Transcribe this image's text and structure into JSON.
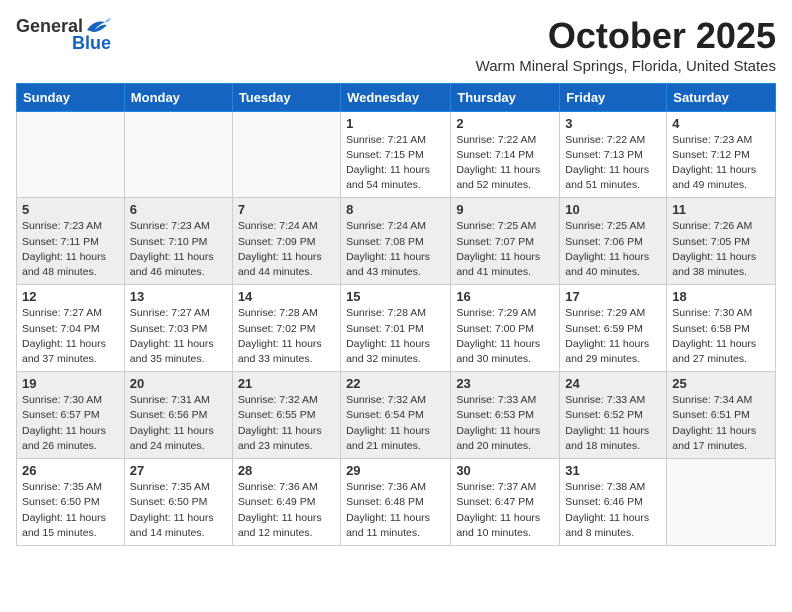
{
  "header": {
    "logo_general": "General",
    "logo_blue": "Blue",
    "month_title": "October 2025",
    "location": "Warm Mineral Springs, Florida, United States"
  },
  "calendar": {
    "days_of_week": [
      "Sunday",
      "Monday",
      "Tuesday",
      "Wednesday",
      "Thursday",
      "Friday",
      "Saturday"
    ],
    "weeks": [
      [
        {
          "day": "",
          "info": ""
        },
        {
          "day": "",
          "info": ""
        },
        {
          "day": "",
          "info": ""
        },
        {
          "day": "1",
          "info": "Sunrise: 7:21 AM\nSunset: 7:15 PM\nDaylight: 11 hours\nand 54 minutes."
        },
        {
          "day": "2",
          "info": "Sunrise: 7:22 AM\nSunset: 7:14 PM\nDaylight: 11 hours\nand 52 minutes."
        },
        {
          "day": "3",
          "info": "Sunrise: 7:22 AM\nSunset: 7:13 PM\nDaylight: 11 hours\nand 51 minutes."
        },
        {
          "day": "4",
          "info": "Sunrise: 7:23 AM\nSunset: 7:12 PM\nDaylight: 11 hours\nand 49 minutes."
        }
      ],
      [
        {
          "day": "5",
          "info": "Sunrise: 7:23 AM\nSunset: 7:11 PM\nDaylight: 11 hours\nand 48 minutes."
        },
        {
          "day": "6",
          "info": "Sunrise: 7:23 AM\nSunset: 7:10 PM\nDaylight: 11 hours\nand 46 minutes."
        },
        {
          "day": "7",
          "info": "Sunrise: 7:24 AM\nSunset: 7:09 PM\nDaylight: 11 hours\nand 44 minutes."
        },
        {
          "day": "8",
          "info": "Sunrise: 7:24 AM\nSunset: 7:08 PM\nDaylight: 11 hours\nand 43 minutes."
        },
        {
          "day": "9",
          "info": "Sunrise: 7:25 AM\nSunset: 7:07 PM\nDaylight: 11 hours\nand 41 minutes."
        },
        {
          "day": "10",
          "info": "Sunrise: 7:25 AM\nSunset: 7:06 PM\nDaylight: 11 hours\nand 40 minutes."
        },
        {
          "day": "11",
          "info": "Sunrise: 7:26 AM\nSunset: 7:05 PM\nDaylight: 11 hours\nand 38 minutes."
        }
      ],
      [
        {
          "day": "12",
          "info": "Sunrise: 7:27 AM\nSunset: 7:04 PM\nDaylight: 11 hours\nand 37 minutes."
        },
        {
          "day": "13",
          "info": "Sunrise: 7:27 AM\nSunset: 7:03 PM\nDaylight: 11 hours\nand 35 minutes."
        },
        {
          "day": "14",
          "info": "Sunrise: 7:28 AM\nSunset: 7:02 PM\nDaylight: 11 hours\nand 33 minutes."
        },
        {
          "day": "15",
          "info": "Sunrise: 7:28 AM\nSunset: 7:01 PM\nDaylight: 11 hours\nand 32 minutes."
        },
        {
          "day": "16",
          "info": "Sunrise: 7:29 AM\nSunset: 7:00 PM\nDaylight: 11 hours\nand 30 minutes."
        },
        {
          "day": "17",
          "info": "Sunrise: 7:29 AM\nSunset: 6:59 PM\nDaylight: 11 hours\nand 29 minutes."
        },
        {
          "day": "18",
          "info": "Sunrise: 7:30 AM\nSunset: 6:58 PM\nDaylight: 11 hours\nand 27 minutes."
        }
      ],
      [
        {
          "day": "19",
          "info": "Sunrise: 7:30 AM\nSunset: 6:57 PM\nDaylight: 11 hours\nand 26 minutes."
        },
        {
          "day": "20",
          "info": "Sunrise: 7:31 AM\nSunset: 6:56 PM\nDaylight: 11 hours\nand 24 minutes."
        },
        {
          "day": "21",
          "info": "Sunrise: 7:32 AM\nSunset: 6:55 PM\nDaylight: 11 hours\nand 23 minutes."
        },
        {
          "day": "22",
          "info": "Sunrise: 7:32 AM\nSunset: 6:54 PM\nDaylight: 11 hours\nand 21 minutes."
        },
        {
          "day": "23",
          "info": "Sunrise: 7:33 AM\nSunset: 6:53 PM\nDaylight: 11 hours\nand 20 minutes."
        },
        {
          "day": "24",
          "info": "Sunrise: 7:33 AM\nSunset: 6:52 PM\nDaylight: 11 hours\nand 18 minutes."
        },
        {
          "day": "25",
          "info": "Sunrise: 7:34 AM\nSunset: 6:51 PM\nDaylight: 11 hours\nand 17 minutes."
        }
      ],
      [
        {
          "day": "26",
          "info": "Sunrise: 7:35 AM\nSunset: 6:50 PM\nDaylight: 11 hours\nand 15 minutes."
        },
        {
          "day": "27",
          "info": "Sunrise: 7:35 AM\nSunset: 6:50 PM\nDaylight: 11 hours\nand 14 minutes."
        },
        {
          "day": "28",
          "info": "Sunrise: 7:36 AM\nSunset: 6:49 PM\nDaylight: 11 hours\nand 12 minutes."
        },
        {
          "day": "29",
          "info": "Sunrise: 7:36 AM\nSunset: 6:48 PM\nDaylight: 11 hours\nand 11 minutes."
        },
        {
          "day": "30",
          "info": "Sunrise: 7:37 AM\nSunset: 6:47 PM\nDaylight: 11 hours\nand 10 minutes."
        },
        {
          "day": "31",
          "info": "Sunrise: 7:38 AM\nSunset: 6:46 PM\nDaylight: 11 hours\nand 8 minutes."
        },
        {
          "day": "",
          "info": ""
        }
      ]
    ]
  }
}
